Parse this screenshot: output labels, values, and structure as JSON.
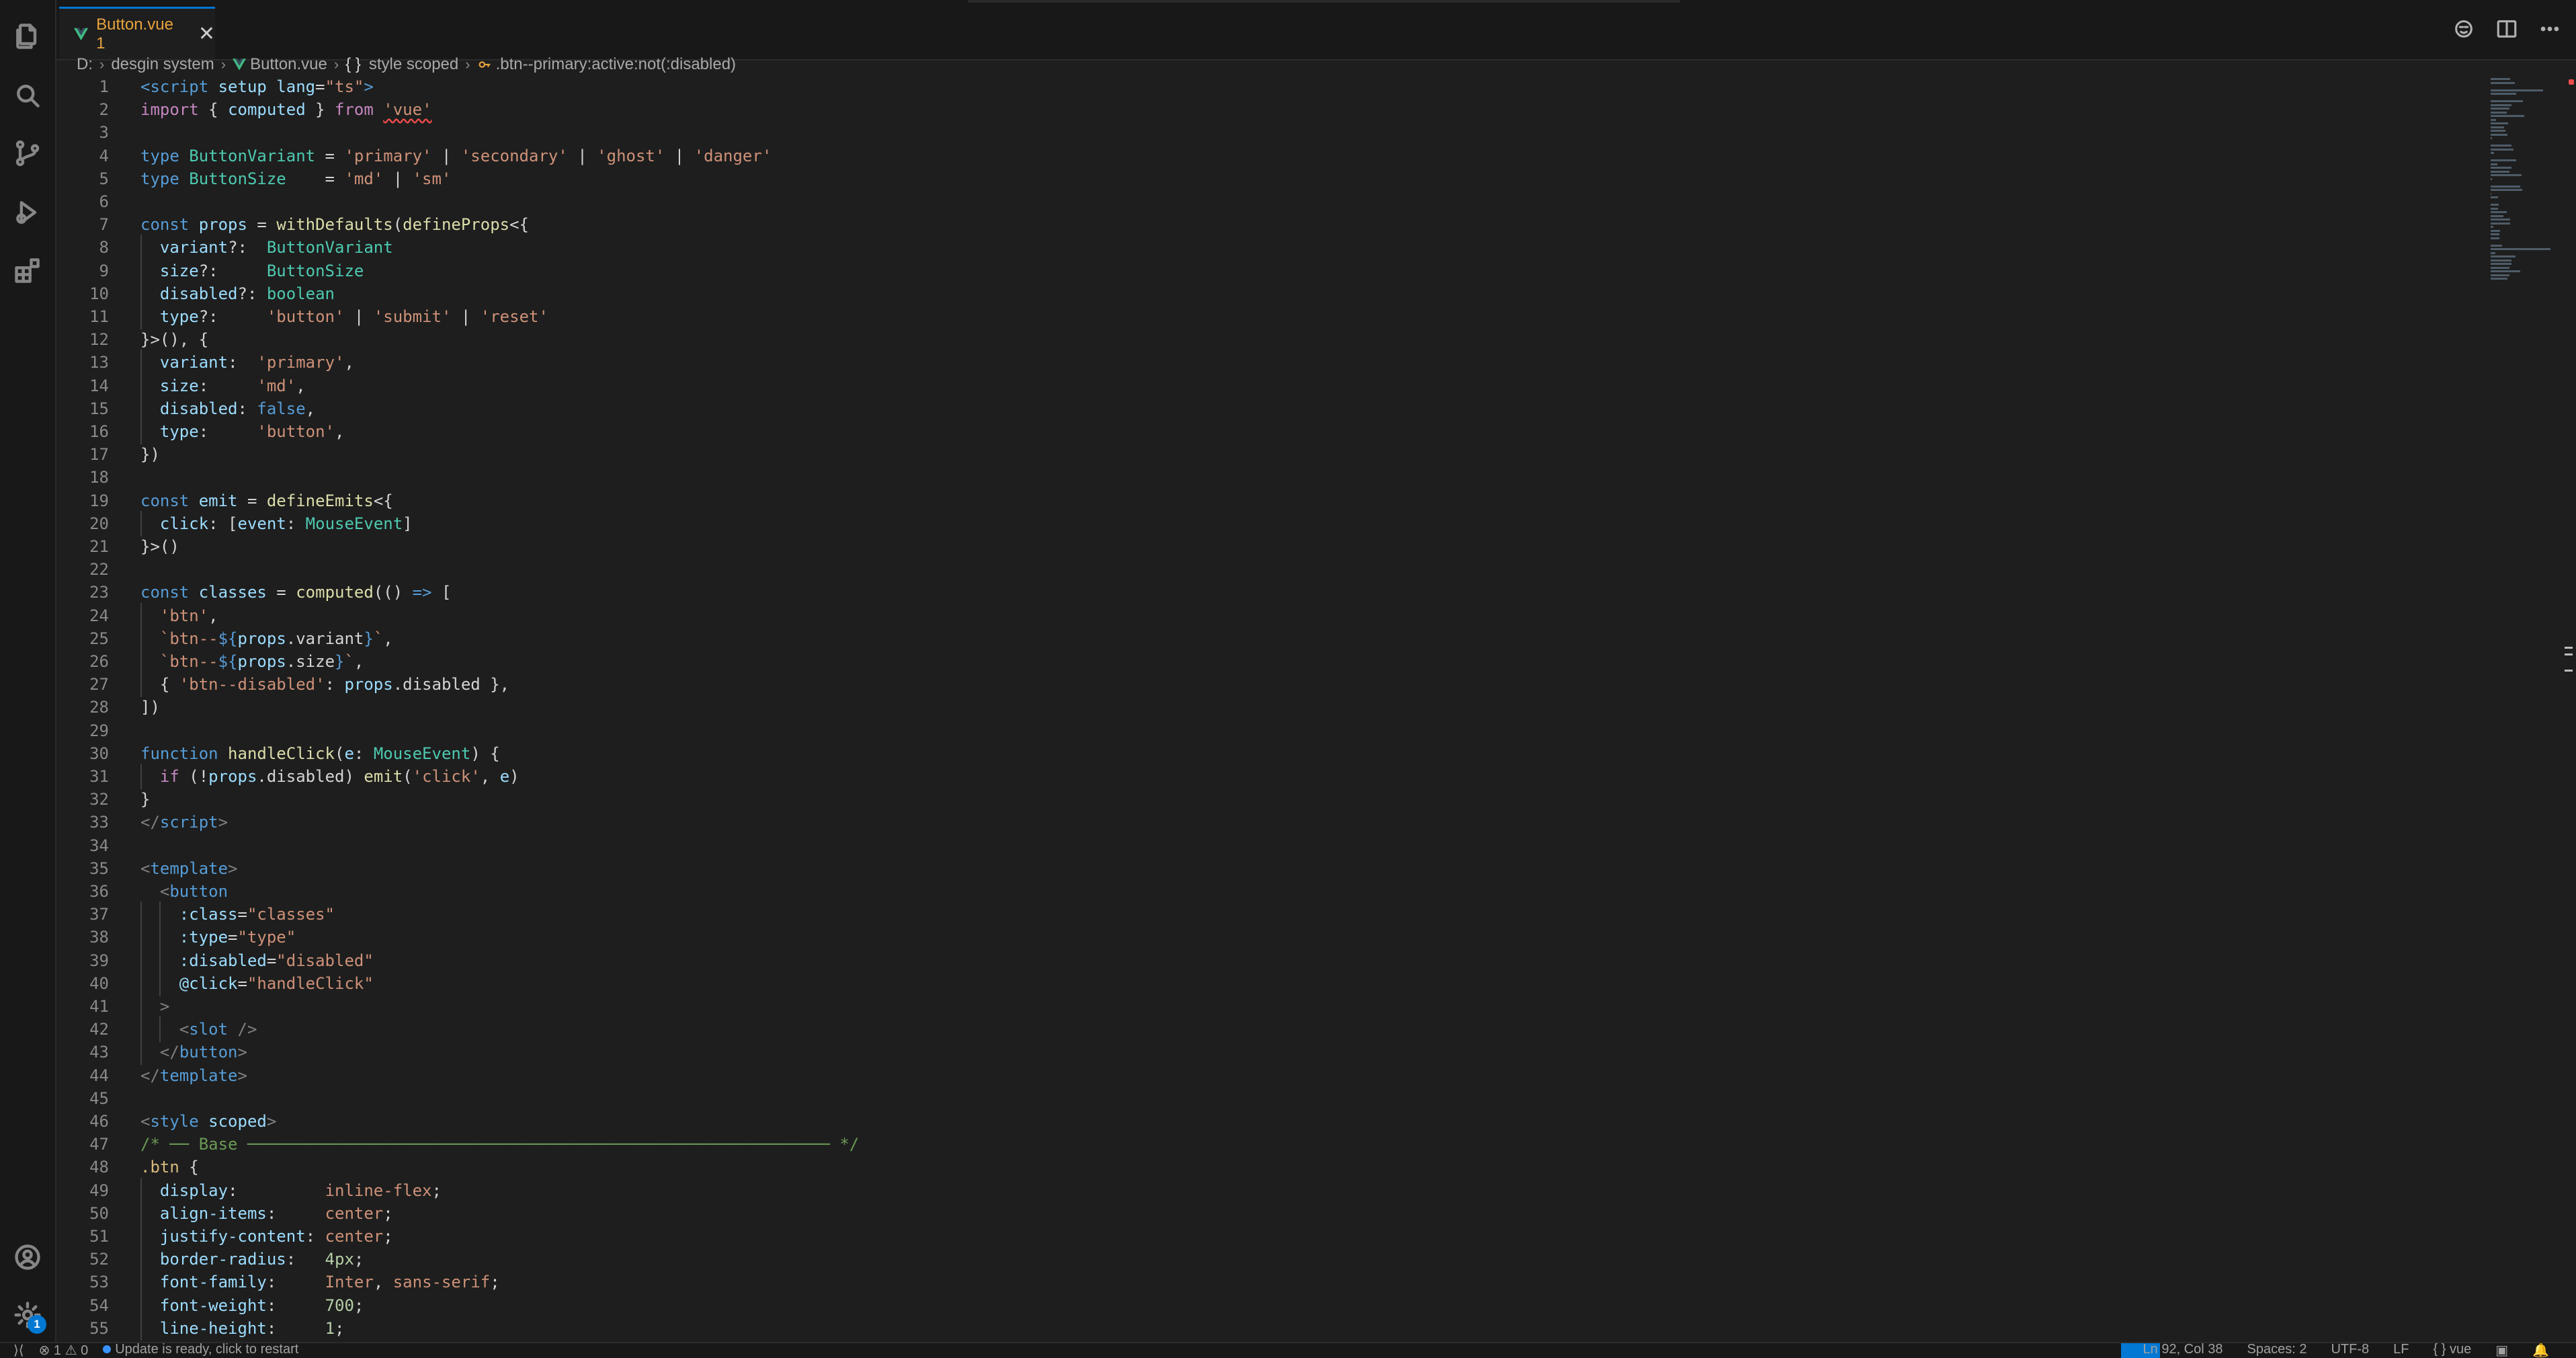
{
  "tab": {
    "title": "Button.vue 1",
    "close": "✕"
  },
  "breadcrumb": {
    "drive": "D:",
    "folder": "desgin system",
    "file": "Button.vue",
    "section_icon": "{ }",
    "section": "style scoped",
    "symbol": ".btn--primary:active:not(:disabled)"
  },
  "icons": {
    "activity": [
      "explorer-icon",
      "search-icon",
      "source-control-icon",
      "run-debug-icon",
      "extensions-icon",
      "account-icon",
      "settings-gear-icon"
    ],
    "tab_actions": [
      "copilot-icon",
      "split-editor-icon",
      "more-actions-icon"
    ]
  },
  "settings_badge": "1",
  "colors": {
    "accent": "#0078d4",
    "tab_text": "#e8a33c",
    "vue_green": "#41b883"
  },
  "statusbar": {
    "problems": "⊗ 1 ⚠ 0",
    "notice": "Update is ready, click to restart",
    "position": "Ln 92, Col 38",
    "spaces": "Spaces: 2",
    "encoding": "UTF-8",
    "eol": "LF",
    "language": "{ } vue"
  },
  "code_lines": [
    {
      "n": "1",
      "t": [
        [
          "tag",
          "<script"
        ],
        [
          "attr",
          " setup"
        ],
        [
          "attr",
          " lang"
        ],
        [
          "",
          "="
        ],
        [
          "str",
          "\"ts\""
        ],
        [
          "tag",
          ">"
        ]
      ]
    },
    {
      "n": "2",
      "t": [
        [
          "ctl",
          "import"
        ],
        [
          "",
          " { "
        ],
        [
          "var",
          "computed"
        ],
        [
          "",
          " } "
        ],
        [
          "ctl",
          "from"
        ],
        [
          "",
          " "
        ],
        [
          "str squig",
          "'vue'"
        ]
      ]
    },
    {
      "n": "3",
      "t": []
    },
    {
      "n": "4",
      "t": [
        [
          "kw",
          "type"
        ],
        [
          "",
          " "
        ],
        [
          "type",
          "ButtonVariant"
        ],
        [
          "",
          " = "
        ],
        [
          "str",
          "'primary'"
        ],
        [
          "",
          " | "
        ],
        [
          "str",
          "'secondary'"
        ],
        [
          "",
          " | "
        ],
        [
          "str",
          "'ghost'"
        ],
        [
          "",
          " | "
        ],
        [
          "str",
          "'danger'"
        ]
      ]
    },
    {
      "n": "5",
      "t": [
        [
          "kw",
          "type"
        ],
        [
          "",
          " "
        ],
        [
          "type",
          "ButtonSize"
        ],
        [
          "",
          "    = "
        ],
        [
          "str",
          "'md'"
        ],
        [
          "",
          " | "
        ],
        [
          "str",
          "'sm'"
        ]
      ]
    },
    {
      "n": "6",
      "t": []
    },
    {
      "n": "7",
      "t": [
        [
          "kw",
          "const"
        ],
        [
          "",
          " "
        ],
        [
          "var",
          "props"
        ],
        [
          "",
          " = "
        ],
        [
          "fn",
          "withDefaults"
        ],
        [
          "",
          "("
        ],
        [
          "fn",
          "defineProps"
        ],
        [
          "",
          "<{"
        ]
      ]
    },
    {
      "n": "8",
      "t": [
        [
          "",
          "  "
        ],
        [
          "prop",
          "variant"
        ],
        [
          "",
          "?:  "
        ],
        [
          "type",
          "ButtonVariant"
        ]
      ]
    },
    {
      "n": "9",
      "t": [
        [
          "",
          "  "
        ],
        [
          "prop",
          "size"
        ],
        [
          "",
          "?:     "
        ],
        [
          "type",
          "ButtonSize"
        ]
      ]
    },
    {
      "n": "10",
      "t": [
        [
          "",
          "  "
        ],
        [
          "prop",
          "disabled"
        ],
        [
          "",
          "?: "
        ],
        [
          "type",
          "boolean"
        ]
      ]
    },
    {
      "n": "11",
      "t": [
        [
          "",
          "  "
        ],
        [
          "prop",
          "type"
        ],
        [
          "",
          "?:     "
        ],
        [
          "str",
          "'button'"
        ],
        [
          "",
          " | "
        ],
        [
          "str",
          "'submit'"
        ],
        [
          "",
          " | "
        ],
        [
          "str",
          "'reset'"
        ]
      ]
    },
    {
      "n": "12",
      "t": [
        [
          "",
          "}>(), {"
        ]
      ]
    },
    {
      "n": "13",
      "t": [
        [
          "",
          "  "
        ],
        [
          "prop",
          "variant"
        ],
        [
          "",
          ":  "
        ],
        [
          "str",
          "'primary'"
        ],
        [
          "",
          ","
        ]
      ]
    },
    {
      "n": "14",
      "t": [
        [
          "",
          "  "
        ],
        [
          "prop",
          "size"
        ],
        [
          "",
          ":     "
        ],
        [
          "str",
          "'md'"
        ],
        [
          "",
          ","
        ]
      ]
    },
    {
      "n": "15",
      "t": [
        [
          "",
          "  "
        ],
        [
          "prop",
          "disabled"
        ],
        [
          "",
          ": "
        ],
        [
          "kw",
          "false"
        ],
        [
          "",
          ","
        ]
      ]
    },
    {
      "n": "16",
      "t": [
        [
          "",
          "  "
        ],
        [
          "prop",
          "type"
        ],
        [
          "",
          ":     "
        ],
        [
          "str",
          "'button'"
        ],
        [
          "",
          ","
        ]
      ]
    },
    {
      "n": "17",
      "t": [
        [
          "",
          "})"
        ]
      ]
    },
    {
      "n": "18",
      "t": []
    },
    {
      "n": "19",
      "t": [
        [
          "kw",
          "const"
        ],
        [
          "",
          " "
        ],
        [
          "var",
          "emit"
        ],
        [
          "",
          " = "
        ],
        [
          "fn",
          "defineEmits"
        ],
        [
          "",
          "<{"
        ]
      ]
    },
    {
      "n": "20",
      "t": [
        [
          "",
          "  "
        ],
        [
          "prop",
          "click"
        ],
        [
          "",
          ": ["
        ],
        [
          "var",
          "event"
        ],
        [
          "",
          ": "
        ],
        [
          "type",
          "MouseEvent"
        ],
        [
          "",
          "]"
        ]
      ]
    },
    {
      "n": "21",
      "t": [
        [
          "",
          "}>()"
        ]
      ]
    },
    {
      "n": "22",
      "t": []
    },
    {
      "n": "23",
      "t": [
        [
          "kw",
          "const"
        ],
        [
          "",
          " "
        ],
        [
          "var",
          "classes"
        ],
        [
          "",
          " = "
        ],
        [
          "fn",
          "computed"
        ],
        [
          "",
          "(() "
        ],
        [
          "kw",
          "=>"
        ],
        [
          "",
          " ["
        ]
      ]
    },
    {
      "n": "24",
      "t": [
        [
          "",
          "  "
        ],
        [
          "str",
          "'btn'"
        ],
        [
          "",
          ","
        ]
      ]
    },
    {
      "n": "25",
      "t": [
        [
          "",
          "  "
        ],
        [
          "str",
          "`btn--"
        ],
        [
          "kw",
          "${"
        ],
        [
          "var",
          "props"
        ],
        [
          "",
          ".variant"
        ],
        [
          "kw",
          "}"
        ],
        [
          "str",
          "`"
        ],
        [
          "",
          ","
        ]
      ]
    },
    {
      "n": "26",
      "t": [
        [
          "",
          "  "
        ],
        [
          "str",
          "`btn--"
        ],
        [
          "kw",
          "${"
        ],
        [
          "var",
          "props"
        ],
        [
          "",
          ".size"
        ],
        [
          "kw",
          "}"
        ],
        [
          "str",
          "`"
        ],
        [
          "",
          ","
        ]
      ]
    },
    {
      "n": "27",
      "t": [
        [
          "",
          "  { "
        ],
        [
          "str",
          "'btn--disabled'"
        ],
        [
          "",
          ": "
        ],
        [
          "var",
          "props"
        ],
        [
          "",
          ".disabled },"
        ]
      ]
    },
    {
      "n": "28",
      "t": [
        [
          "",
          "])"
        ]
      ]
    },
    {
      "n": "29",
      "t": []
    },
    {
      "n": "30",
      "t": [
        [
          "kw",
          "function"
        ],
        [
          "",
          " "
        ],
        [
          "fn",
          "handleClick"
        ],
        [
          "",
          "("
        ],
        [
          "var",
          "e"
        ],
        [
          "",
          ": "
        ],
        [
          "type",
          "MouseEvent"
        ],
        [
          "",
          ") {"
        ]
      ]
    },
    {
      "n": "31",
      "t": [
        [
          "",
          "  "
        ],
        [
          "ctl",
          "if"
        ],
        [
          "",
          " (!"
        ],
        [
          "var",
          "props"
        ],
        [
          "",
          ".disabled) "
        ],
        [
          "fn",
          "emit"
        ],
        [
          "",
          "("
        ],
        [
          "str",
          "'click'"
        ],
        [
          "",
          ", "
        ],
        [
          "var",
          "e"
        ],
        [
          "",
          ")"
        ]
      ]
    },
    {
      "n": "32",
      "t": [
        [
          "",
          "}"
        ]
      ]
    },
    {
      "n": "33",
      "t": [
        [
          "punc",
          "</"
        ],
        [
          "tag",
          "script"
        ],
        [
          "punc",
          ">"
        ]
      ]
    },
    {
      "n": "34",
      "t": []
    },
    {
      "n": "35",
      "t": [
        [
          "punc",
          "<"
        ],
        [
          "tag",
          "template"
        ],
        [
          "punc",
          ">"
        ]
      ]
    },
    {
      "n": "36",
      "t": [
        [
          "",
          "  "
        ],
        [
          "punc",
          "<"
        ],
        [
          "tag",
          "button"
        ]
      ]
    },
    {
      "n": "37",
      "t": [
        [
          "",
          "    "
        ],
        [
          "attr",
          ":class"
        ],
        [
          "",
          "="
        ],
        [
          "str",
          "\"classes\""
        ]
      ]
    },
    {
      "n": "38",
      "t": [
        [
          "",
          "    "
        ],
        [
          "attr",
          ":type"
        ],
        [
          "",
          "="
        ],
        [
          "str",
          "\"type\""
        ]
      ]
    },
    {
      "n": "39",
      "t": [
        [
          "",
          "    "
        ],
        [
          "attr",
          ":disabled"
        ],
        [
          "",
          "="
        ],
        [
          "str",
          "\"disabled\""
        ]
      ]
    },
    {
      "n": "40",
      "t": [
        [
          "",
          "    "
        ],
        [
          "attr",
          "@click"
        ],
        [
          "",
          "="
        ],
        [
          "str",
          "\"handleClick\""
        ]
      ]
    },
    {
      "n": "41",
      "t": [
        [
          "",
          "  "
        ],
        [
          "punc",
          ">"
        ]
      ]
    },
    {
      "n": "42",
      "t": [
        [
          "",
          "    "
        ],
        [
          "punc",
          "<"
        ],
        [
          "tag",
          "slot"
        ],
        [
          "",
          " "
        ],
        [
          "punc",
          "/>"
        ]
      ]
    },
    {
      "n": "43",
      "t": [
        [
          "",
          "  "
        ],
        [
          "punc",
          "</"
        ],
        [
          "tag",
          "button"
        ],
        [
          "punc",
          ">"
        ]
      ]
    },
    {
      "n": "44",
      "t": [
        [
          "punc",
          "</"
        ],
        [
          "tag",
          "template"
        ],
        [
          "punc",
          ">"
        ]
      ]
    },
    {
      "n": "45",
      "t": []
    },
    {
      "n": "46",
      "t": [
        [
          "punc",
          "<"
        ],
        [
          "tag",
          "style"
        ],
        [
          "",
          " "
        ],
        [
          "attr",
          "scoped"
        ],
        [
          "punc",
          ">"
        ]
      ]
    },
    {
      "n": "47",
      "t": [
        [
          "cmt",
          "/* ── Base ──────────────────────────────────────────────────────────── */"
        ]
      ]
    },
    {
      "n": "48",
      "t": [
        [
          "sel",
          ".btn"
        ],
        [
          "",
          " {"
        ]
      ]
    },
    {
      "n": "49",
      "t": [
        [
          "",
          "  "
        ],
        [
          "prop",
          "display"
        ],
        [
          "",
          ":         "
        ],
        [
          "str",
          "inline-flex"
        ],
        [
          "",
          ";"
        ]
      ]
    },
    {
      "n": "50",
      "t": [
        [
          "",
          "  "
        ],
        [
          "prop",
          "align-items"
        ],
        [
          "",
          ":     "
        ],
        [
          "str",
          "center"
        ],
        [
          "",
          ";"
        ]
      ]
    },
    {
      "n": "51",
      "t": [
        [
          "",
          "  "
        ],
        [
          "prop",
          "justify-content"
        ],
        [
          "",
          ": "
        ],
        [
          "str",
          "center"
        ],
        [
          "",
          ";"
        ]
      ]
    },
    {
      "n": "52",
      "t": [
        [
          "",
          "  "
        ],
        [
          "prop",
          "border-radius"
        ],
        [
          "",
          ":   "
        ],
        [
          "num",
          "4px"
        ],
        [
          "",
          ";"
        ]
      ]
    },
    {
      "n": "53",
      "t": [
        [
          "",
          "  "
        ],
        [
          "prop",
          "font-family"
        ],
        [
          "",
          ":     "
        ],
        [
          "str",
          "Inter"
        ],
        [
          "",
          ", "
        ],
        [
          "str",
          "sans-serif"
        ],
        [
          "",
          ";"
        ]
      ]
    },
    {
      "n": "54",
      "t": [
        [
          "",
          "  "
        ],
        [
          "prop",
          "font-weight"
        ],
        [
          "",
          ":     "
        ],
        [
          "num",
          "700"
        ],
        [
          "",
          ";"
        ]
      ]
    },
    {
      "n": "55",
      "t": [
        [
          "",
          "  "
        ],
        [
          "prop",
          "line-height"
        ],
        [
          "",
          ":     "
        ],
        [
          "num",
          "1"
        ],
        [
          "",
          ";"
        ]
      ]
    }
  ]
}
